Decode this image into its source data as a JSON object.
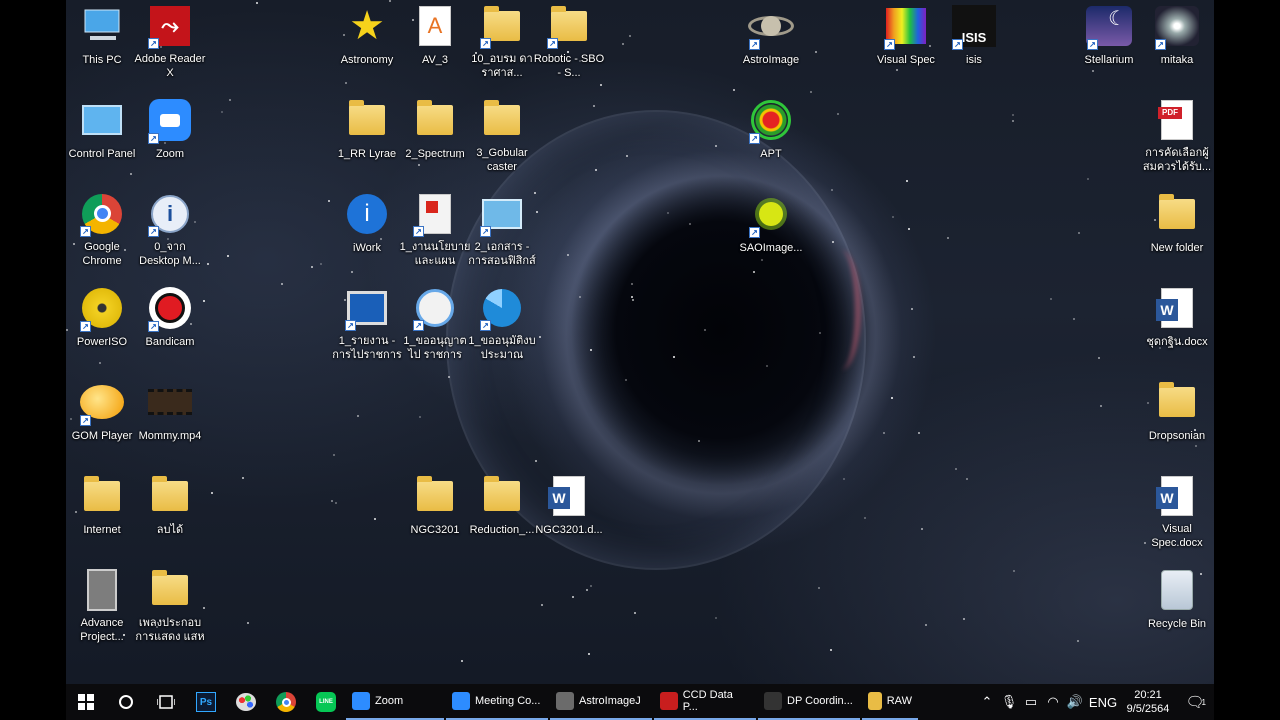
{
  "desktop_icons": [
    {
      "name": "this-pc",
      "label": "This PC"
    },
    {
      "name": "adobe-reader",
      "label": "Adobe Reader X"
    },
    {
      "name": "control-panel",
      "label": "Control Panel"
    },
    {
      "name": "zoom",
      "label": "Zoom"
    },
    {
      "name": "google-chrome",
      "label": "Google Chrome"
    },
    {
      "name": "desktop-m",
      "label": "0_จาก Desktop M..."
    },
    {
      "name": "poweriso",
      "label": "PowerISO"
    },
    {
      "name": "bandicam",
      "label": "Bandicam"
    },
    {
      "name": "gom-player",
      "label": "GOM Player"
    },
    {
      "name": "mommy-mp4",
      "label": "Mommy.mp4"
    },
    {
      "name": "internet",
      "label": "Internet"
    },
    {
      "name": "lobtai",
      "label": "ลบได้"
    },
    {
      "name": "advance-project",
      "label": "Advance Project..."
    },
    {
      "name": "phleng-prakop",
      "label": "เพลงประกอบ การแสดง แสห"
    },
    {
      "name": "astronomy",
      "label": "Astronomy"
    },
    {
      "name": "av-3",
      "label": "AV_3"
    },
    {
      "name": "folder-10",
      "label": "10_อบรม ดาราศาส..."
    },
    {
      "name": "robotic-sbo",
      "label": "Robotic - SBO - S..."
    },
    {
      "name": "rr-lyrae",
      "label": "1_RR Lyrae"
    },
    {
      "name": "spectrum",
      "label": "2_Spectrum"
    },
    {
      "name": "gobular-caster",
      "label": "3_Gobular caster"
    },
    {
      "name": "iwork",
      "label": "iWork"
    },
    {
      "name": "ngan-nayobai",
      "label": "1_งานนโยบาย และแผน"
    },
    {
      "name": "ekkasan",
      "label": "2_เอกสาร - การสอนฟิสิกส์"
    },
    {
      "name": "rainngan",
      "label": "1_รายงาน - การไปราชการ"
    },
    {
      "name": "khoanumat",
      "label": "1_ขออนุญาตไป ราชการ"
    },
    {
      "name": "khoanumat-ngop",
      "label": "1_ขออนุมัติงบ ประมาณ"
    },
    {
      "name": "ngc3201-folder",
      "label": "NGC3201"
    },
    {
      "name": "reduction",
      "label": "Reduction_..."
    },
    {
      "name": "ngc3201-doc",
      "label": "NGC3201.d..."
    },
    {
      "name": "astroimage",
      "label": "AstroImage"
    },
    {
      "name": "apt",
      "label": "APT"
    },
    {
      "name": "saoimage",
      "label": "SAOImage..."
    },
    {
      "name": "visual-spec",
      "label": "Visual Spec"
    },
    {
      "name": "isis",
      "label": "isis"
    },
    {
      "name": "stellarium",
      "label": "Stellarium"
    },
    {
      "name": "mitaka",
      "label": "mitaka"
    },
    {
      "name": "pdf-file",
      "label": "การคัดเลือกผู้ สมควรได้รับ..."
    },
    {
      "name": "new-folder",
      "label": "New folder"
    },
    {
      "name": "chutkhwam",
      "label": "ชุดกฐิน.docx"
    },
    {
      "name": "dropsonian",
      "label": "Dropsonian"
    },
    {
      "name": "visual-spec-docx",
      "label": "Visual Spec.docx"
    },
    {
      "name": "recycle-bin",
      "label": "Recycle Bin"
    }
  ],
  "taskbar": {
    "apps": [
      {
        "label": "Zoom",
        "color": "#2d8cff"
      },
      {
        "label": "Meeting Co...",
        "color": "#2d8cff"
      },
      {
        "label": "AstroImageJ",
        "color": "#6b6b6b"
      },
      {
        "label": "CCD Data P...",
        "color": "#c81e1e"
      },
      {
        "label": "DP Coordin...",
        "color": "#333333"
      },
      {
        "label": "RAW",
        "color": "#e9bc45"
      }
    ],
    "language": "ENG",
    "time": "20:21",
    "date": "9/5/2564",
    "notification_count": "1"
  }
}
